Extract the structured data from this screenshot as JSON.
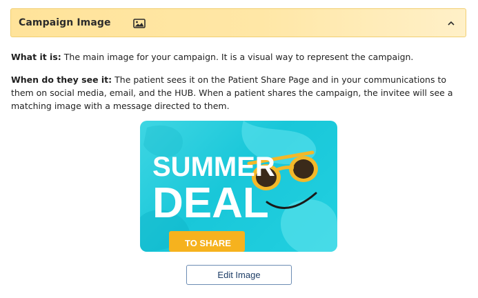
{
  "panel": {
    "title": "Campaign Image",
    "icon": "image-icon",
    "toggle_icon": "chevron-up-icon",
    "header_color": "#ffe39a"
  },
  "description": {
    "what_label": "What it is:",
    "what_text": " The main image for your campaign. It is a visual way to represent the campaign.",
    "when_label": "When do they see it:",
    "when_text": " The patient sees it on the Patient Share Page and in your communications to them on social media, email, and the HUB. When a patient shares the campaign, the invitee will see a matching image with a message directed to them."
  },
  "campaign_image": {
    "line1": "SUMMER",
    "line2": "DEAL",
    "cta": "TO SHARE",
    "background_color": "#19c7d9",
    "cta_color": "#f6b21e"
  },
  "actions": {
    "edit_label": "Edit Image"
  }
}
